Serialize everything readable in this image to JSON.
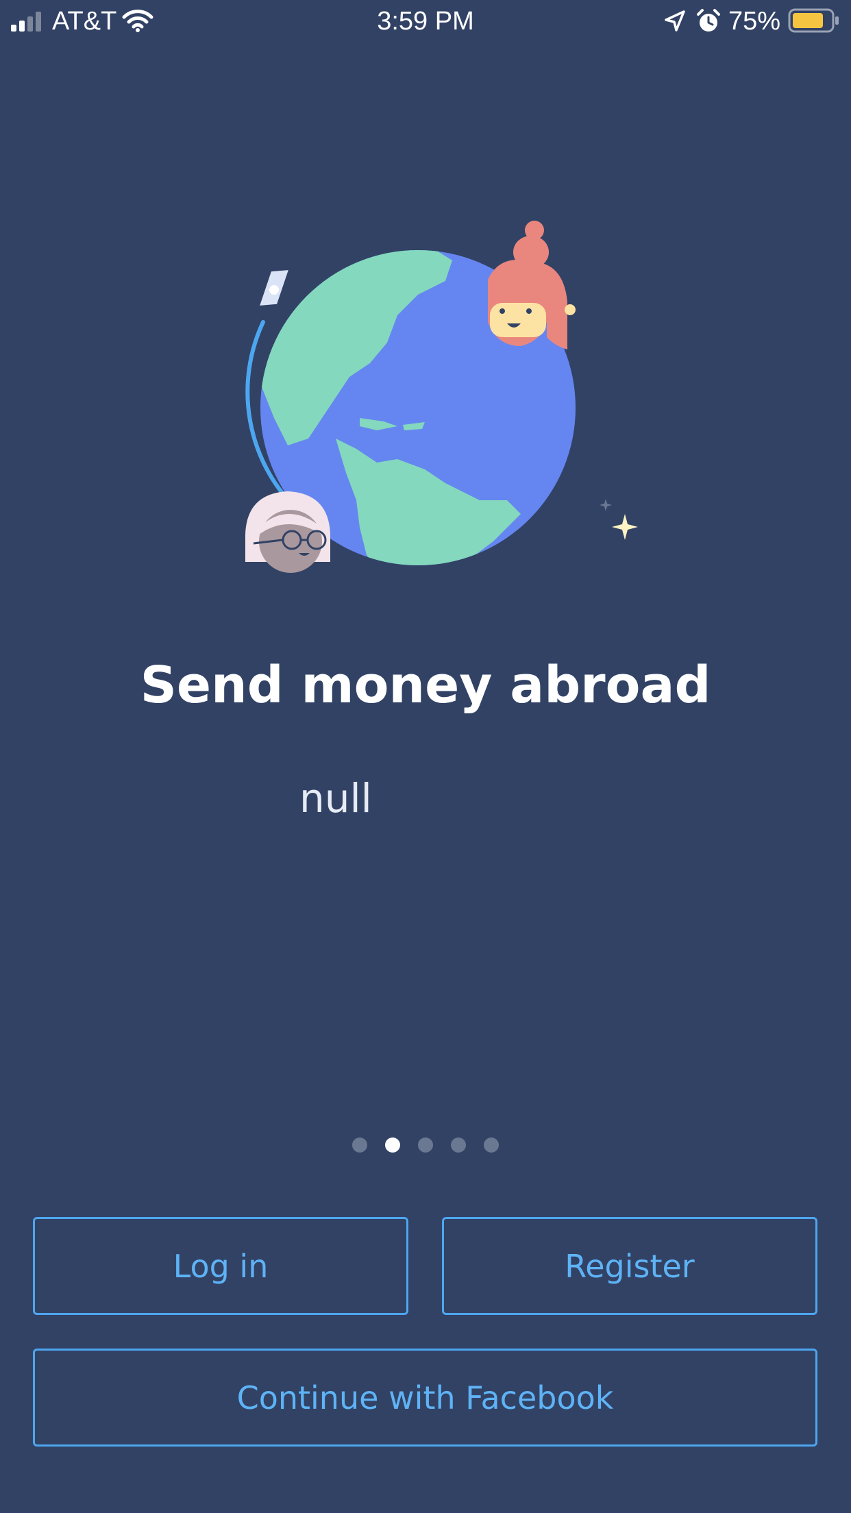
{
  "status_bar": {
    "carrier": "AT&T",
    "time": "3:59 PM",
    "battery_percent": "75%",
    "icons": [
      "signal-icon",
      "wifi-icon",
      "location-icon",
      "alarm-icon",
      "battery-icon"
    ],
    "battery_color": "#f5c542"
  },
  "onboarding": {
    "title": "Send money abroad",
    "subtitle": "null",
    "illustration": "globe-with-people-illustration",
    "pages": 5,
    "active_page": 2
  },
  "actions": {
    "login_label": "Log in",
    "register_label": "Register",
    "facebook_label": "Continue with Facebook"
  },
  "colors": {
    "background": "#324265",
    "accent": "#4da6f0"
  }
}
